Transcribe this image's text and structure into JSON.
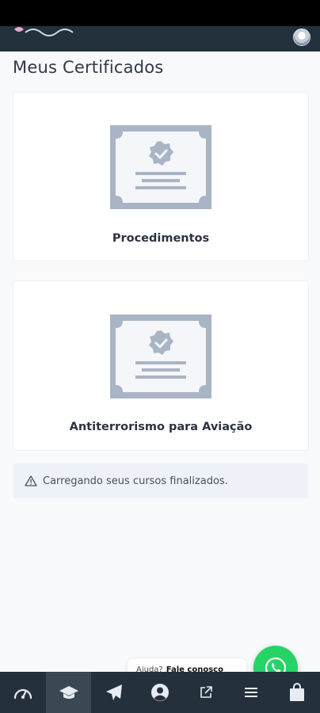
{
  "page": {
    "title": "Meus Certificados"
  },
  "certificates": [
    {
      "title": "Procedimentos"
    },
    {
      "title": "Antiterrorismo para Aviação"
    }
  ],
  "alert": {
    "icon": "warning-icon",
    "text": "Carregando seus cursos finalizados."
  },
  "help": {
    "question": "Ajuda?",
    "link": "Fale conosco"
  },
  "whatsapp": {
    "icon": "whatsapp-icon",
    "color": "#25d366"
  },
  "bottom_nav": [
    {
      "icon": "speedometer-icon",
      "active": false
    },
    {
      "icon": "graduation-cap-icon",
      "active": true
    },
    {
      "icon": "paper-plane-icon",
      "active": false
    },
    {
      "icon": "user-circle-icon",
      "active": false
    },
    {
      "icon": "external-link-icon",
      "active": false
    },
    {
      "icon": "menu-icon",
      "active": false
    },
    {
      "icon": "shopping-bag-icon",
      "active": false
    }
  ],
  "colors": {
    "header": "#23313d",
    "nav": "#24313d",
    "nav_active": "#3b4753",
    "certificate": "#a9b4c4"
  }
}
